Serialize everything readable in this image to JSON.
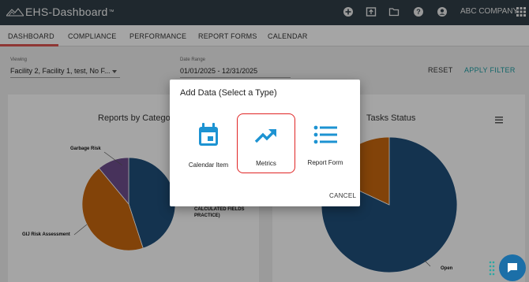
{
  "app": {
    "logo_text": "EHS-Dashboard",
    "logo_tm": "™",
    "company": "ABC COMPANY"
  },
  "top_icons": [
    "add-circle-icon",
    "export-icon",
    "folder-icon",
    "help-icon",
    "account-icon",
    "apps-grid-icon"
  ],
  "nav": {
    "tabs": [
      {
        "label": "DASHBOARD",
        "active": true
      },
      {
        "label": "COMPLIANCE",
        "active": false
      },
      {
        "label": "PERFORMANCE",
        "active": false
      },
      {
        "label": "REPORT FORMS",
        "active": false
      },
      {
        "label": "CALENDAR",
        "active": false
      }
    ]
  },
  "filters": {
    "viewing_label": "Viewing",
    "viewing_value": "Facility 2, Facility 1, test, No F...",
    "date_label": "Date Range",
    "date_value": "01/01/2025 - 12/31/2025",
    "reset_label": "RESET",
    "apply_label": "APPLY FILTER"
  },
  "panels": {
    "left_title": "Reports by Category",
    "right_title": "Tasks Status",
    "left_labels": {
      "garbage": "Garbage Risk",
      "gij": "GIJ Risk Assessment"
    },
    "left_legend_partial": "CALCULATED FIELDS PRACTICE)",
    "right_labels": {
      "open": "Open"
    }
  },
  "chart_data": [
    {
      "type": "pie",
      "title": "Reports by Category",
      "slices": [
        {
          "label": "",
          "value": 45,
          "color": "#1f4e79"
        },
        {
          "label": "GIJ Risk Assessment",
          "value": 44,
          "color": "#c5660f"
        },
        {
          "label": "Garbage Risk",
          "value": 11,
          "color": "#6d4c8a"
        }
      ]
    },
    {
      "type": "pie",
      "title": "Tasks Status",
      "slices": [
        {
          "label": "Open",
          "value": 82,
          "color": "#1f4e79"
        },
        {
          "label": "",
          "value": 18,
          "color": "#c5660f"
        }
      ]
    }
  ],
  "modal": {
    "title": "Add Data (Select a Type)",
    "options": [
      {
        "label": "Calendar Item",
        "icon": "calendar-icon",
        "selected": false
      },
      {
        "label": "Metrics",
        "icon": "trending-up-icon",
        "selected": true
      },
      {
        "label": "Report Form",
        "icon": "list-icon",
        "selected": false
      }
    ],
    "cancel_label": "CANCEL"
  },
  "colors": {
    "topbar": "#2f3e47",
    "accent_teal": "#1a9aa0",
    "icon_blue": "#1d93d2",
    "selected_border": "#e02424",
    "active_tab_underline": "#d9534f"
  }
}
